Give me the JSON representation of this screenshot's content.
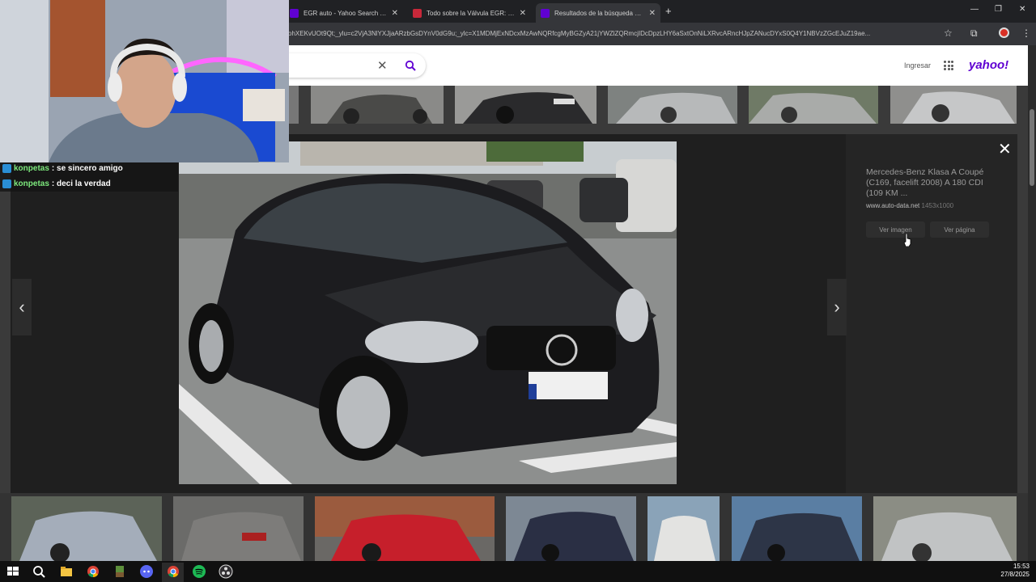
{
  "browser": {
    "tabs": [
      {
        "label": "EGR auto - Yahoo Search Tus re",
        "close": "✕"
      },
      {
        "label": "Todo sobre la Válvula EGR: qué",
        "close": "✕"
      },
      {
        "label": "Resultados de la búsqueda de i",
        "close": "✕"
      }
    ],
    "new_tab": "+",
    "url": "ohXEKvUOt9Qt;_ylu=c2VjA3NlYXJjaARzbGsDYnV0dG9u;_ylc=X1MDMjExNDcxMzAwNQRfcgMyBGZyA21jYWZlZQRmcjIDcDpzLHY6aSxtOnNiLXRvcARncHJpZANucDYxS0Q4Y1NBVzZGcEJuZ19ae..."
  },
  "yahoo": {
    "clear_icon": "✕",
    "login": "Ingresar",
    "logo": "yahoo!"
  },
  "viewer": {
    "title": "Mercedes-Benz Klasa A Coupé (C169, facelift 2008) A 180 CDI (109 KM ...",
    "source": "www.auto-data.net",
    "dimensions": "1453x1000",
    "view_image": "Ver imagen",
    "view_page": "Ver página",
    "close": "✕",
    "prev": "‹",
    "next": "›"
  },
  "chat": [
    {
      "user": "konpetas",
      "message": ": se sincero amigo"
    },
    {
      "user": "konpetas",
      "message": ": deci la verdad"
    }
  ],
  "taskbar": {
    "time": "15:53",
    "date": "27/8/2025"
  },
  "colors": {
    "yahoo_purple": "#6001d2",
    "chat_user": "#7de97d"
  }
}
